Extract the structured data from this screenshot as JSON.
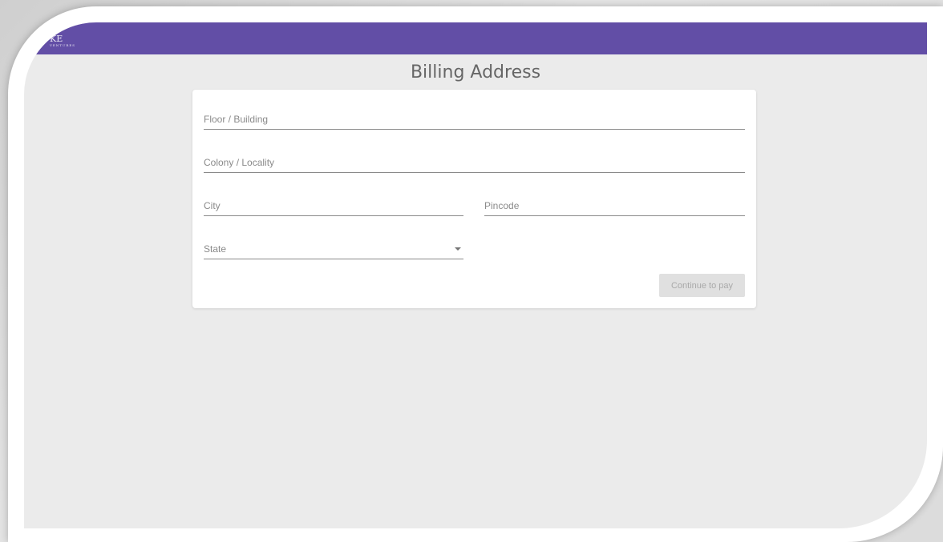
{
  "header": {
    "logo_text": "KE",
    "logo_subtext": "VENTURES",
    "brand_color": "#624ea6"
  },
  "page": {
    "title": "Billing Address"
  },
  "form": {
    "floor_placeholder": "Floor / Building",
    "colony_placeholder": "Colony / Locality",
    "city_placeholder": "City",
    "pincode_placeholder": "Pincode",
    "state_placeholder": "State",
    "state_icon": "chevron-down-icon",
    "submit_label": "Continue to pay"
  }
}
